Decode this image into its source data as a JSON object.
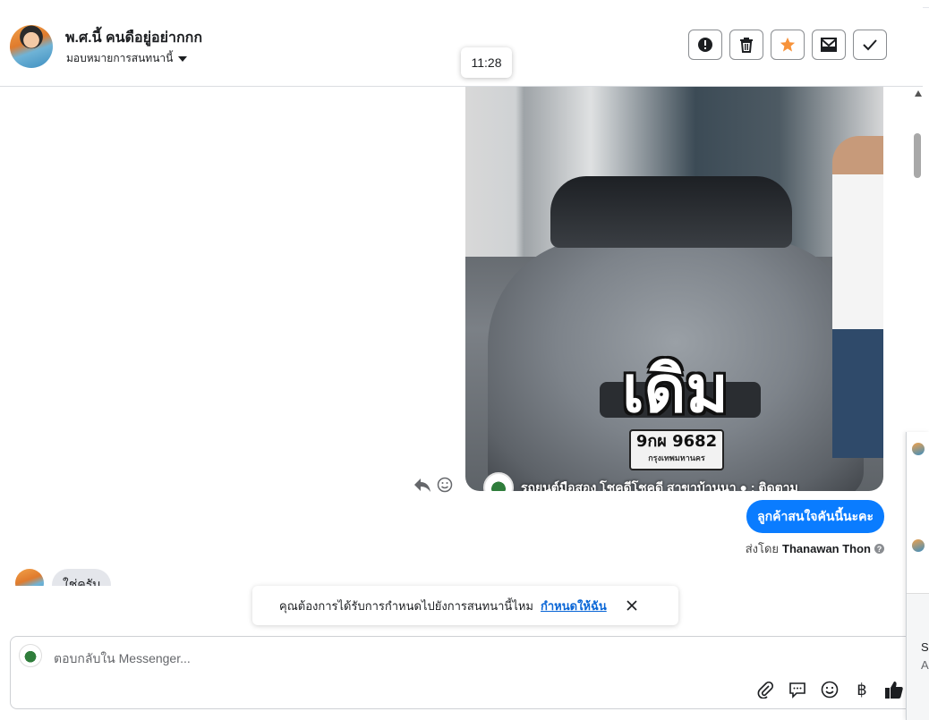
{
  "header": {
    "contact_name": "พ.ศ.นี้ คนดือยู่อย่ากกก",
    "assign_label": "มอบหมายการสนทนานี้",
    "actions": [
      {
        "name": "report-button",
        "icon": "exclamation-circle-icon"
      },
      {
        "name": "delete-button",
        "icon": "trash-icon"
      },
      {
        "name": "star-button",
        "icon": "star-icon",
        "color": "#f7923a"
      },
      {
        "name": "mark-unread-button",
        "icon": "mail-icon"
      },
      {
        "name": "done-button",
        "icon": "check-icon"
      }
    ]
  },
  "tooltip": {
    "time": "11:28"
  },
  "media": {
    "overlay_word": "เดิม",
    "plate_number": "9กผ 9682",
    "plate_province": "กรุงเทพมหานคร",
    "caption": "รถยนต์มือสอง โชคดีโชคดี สาขาบ้านนา ● : ติดตาม"
  },
  "outgoing_message": {
    "text": "ลูกค้าสนใจคันนี้นะคะ",
    "sent_by_label": "ส่งโดย",
    "sent_by_name": "Thanawan Thon",
    "help_glyph": "?"
  },
  "incoming_message": {
    "text": "ใช่ครับ"
  },
  "notice": {
    "text": "คุณต้องการได้รับการกำหนดไปยังการสนทนานี้ไหม",
    "link": "กำหนดให้ฉัน"
  },
  "composer": {
    "placeholder": "ตอบกลับใน Messenger...",
    "tools": [
      "attach-icon",
      "saved-reply-icon",
      "emoji-icon",
      "baht-payment-icon",
      "like-icon"
    ],
    "baht_glyph": "฿"
  },
  "side_panel": {
    "letters_1": "Sc",
    "letters_2": "A"
  },
  "colors": {
    "accent": "#0a7cff",
    "star": "#f7923a",
    "link": "#0a66d6"
  }
}
